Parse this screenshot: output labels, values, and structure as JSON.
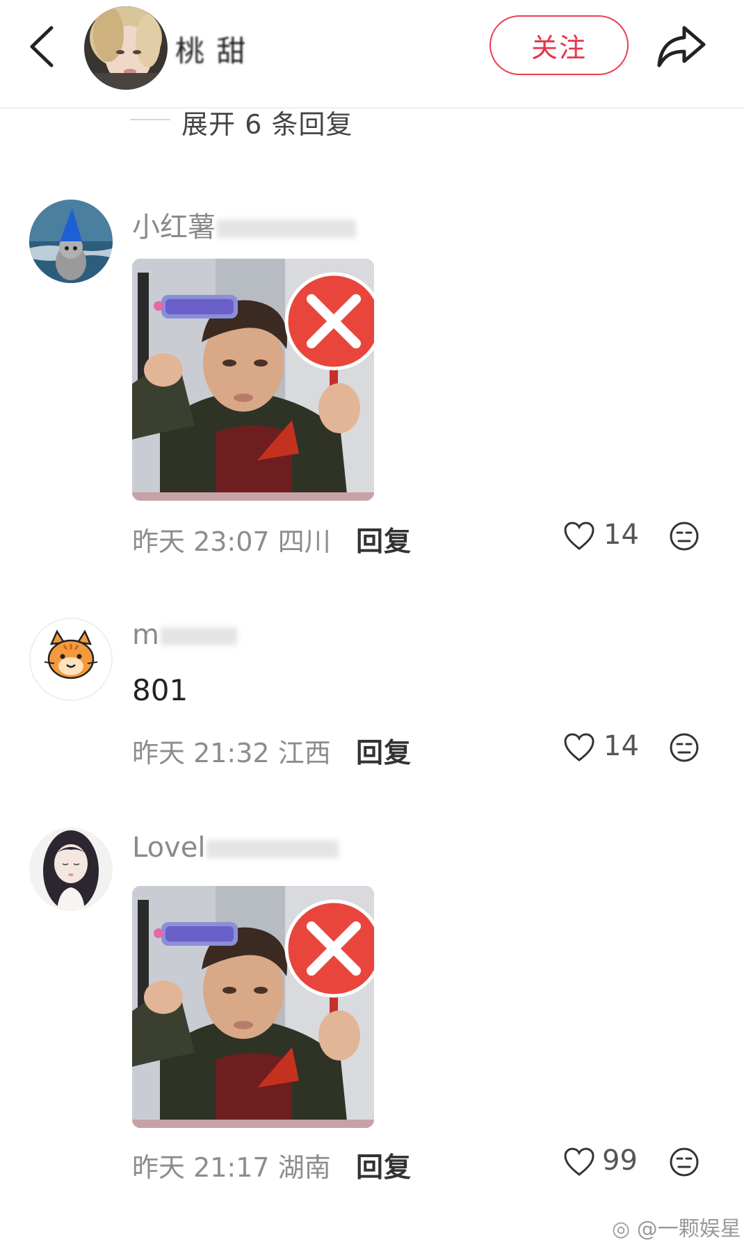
{
  "header": {
    "author_name": "桃 甜",
    "follow_label": "关注"
  },
  "thread": {
    "expand_label": "展开 6 条回复"
  },
  "comments": [
    {
      "username": "小红薯",
      "time": "昨天 23:07",
      "location": "四川",
      "reply_label": "回复",
      "likes": "14",
      "has_image": true
    },
    {
      "username": "m",
      "text": "801",
      "time": "昨天 21:32",
      "location": "江西",
      "reply_label": "回复",
      "likes": "14",
      "has_image": false
    },
    {
      "username": "Lovel",
      "time": "昨天 21:17",
      "location": "湖南",
      "reply_label": "回复",
      "likes": "99",
      "has_image": true
    }
  ],
  "watermark": "@一颗娱星",
  "colors": {
    "accent": "#e8334a",
    "meta": "#8c8c8c"
  }
}
